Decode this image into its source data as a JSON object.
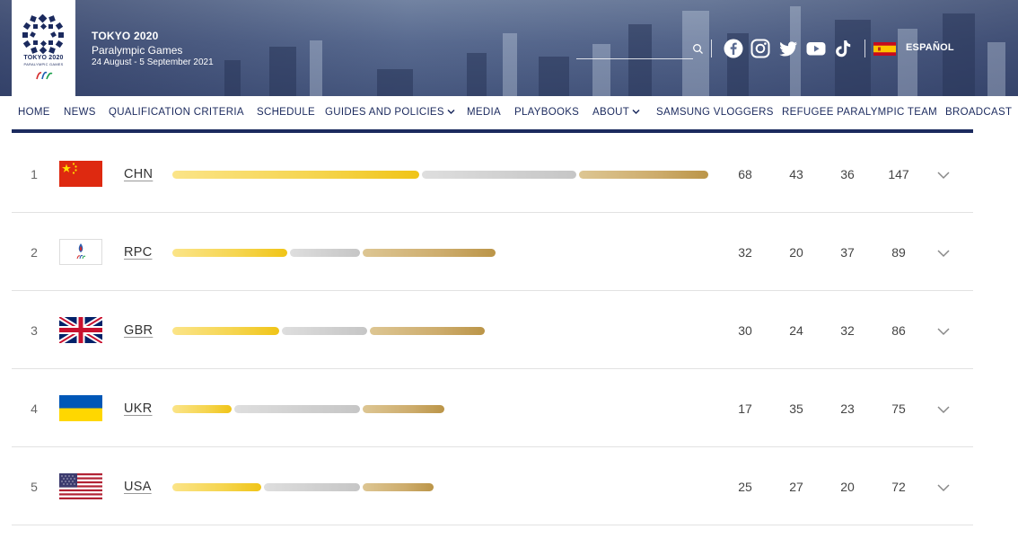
{
  "header": {
    "logo_text": "TOKYO 2020",
    "logo_subtext": "PARALYMPIC GAMES",
    "event_title": "TOKYO 2020",
    "event_subtitle": "Paralympic Games",
    "event_dates": "24 August - 5 September 2021",
    "search": {
      "placeholder": "",
      "value": ""
    },
    "social_icons": [
      "facebook-icon",
      "instagram-icon",
      "twitter-icon",
      "youtube-icon",
      "tiktok-icon"
    ],
    "language": {
      "label": "ESPAÑOL",
      "flag": "spain-flag-icon"
    }
  },
  "nav": {
    "items": [
      {
        "label": "HOME",
        "has_dropdown": false
      },
      {
        "label": "NEWS",
        "has_dropdown": false
      },
      {
        "label": "QUALIFICATION CRITERIA",
        "has_dropdown": false
      },
      {
        "label": "SCHEDULE",
        "has_dropdown": false
      },
      {
        "label": "GUIDES AND POLICIES",
        "has_dropdown": true
      },
      {
        "label": "MEDIA",
        "has_dropdown": false
      },
      {
        "label": "PLAYBOOKS",
        "has_dropdown": false
      },
      {
        "label": "ABOUT",
        "has_dropdown": true
      },
      {
        "label": "SAMSUNG VLOGGERS",
        "has_dropdown": false
      },
      {
        "label": "REFUGEE PARALYMPIC TEAM",
        "has_dropdown": false
      },
      {
        "label": "BROADCAST",
        "has_dropdown": false
      }
    ]
  },
  "medal_table": {
    "rows": [
      {
        "rank": "1",
        "code": "CHN",
        "flag": "china-flag-icon",
        "gold": 68,
        "silver": 43,
        "bronze": 36,
        "total": 147
      },
      {
        "rank": "2",
        "code": "RPC",
        "flag": "rpc-flag-icon",
        "gold": 32,
        "silver": 20,
        "bronze": 37,
        "total": 89
      },
      {
        "rank": "3",
        "code": "GBR",
        "flag": "uk-flag-icon",
        "gold": 30,
        "silver": 24,
        "bronze": 32,
        "total": 86
      },
      {
        "rank": "4",
        "code": "UKR",
        "flag": "ukraine-flag-icon",
        "gold": 17,
        "silver": 35,
        "bronze": 23,
        "total": 75
      },
      {
        "rank": "5",
        "code": "USA",
        "flag": "usa-flag-icon",
        "gold": 25,
        "silver": 27,
        "bronze": 20,
        "total": 72
      }
    ]
  },
  "colors": {
    "navy": "#1b2a5e",
    "gold": "#f5d44c",
    "silver": "#cfcfcf",
    "bronze": "#cdac6c",
    "china_red": "#de2910",
    "ukraine_blue": "#0057b7",
    "ukraine_yellow": "#ffd700"
  }
}
